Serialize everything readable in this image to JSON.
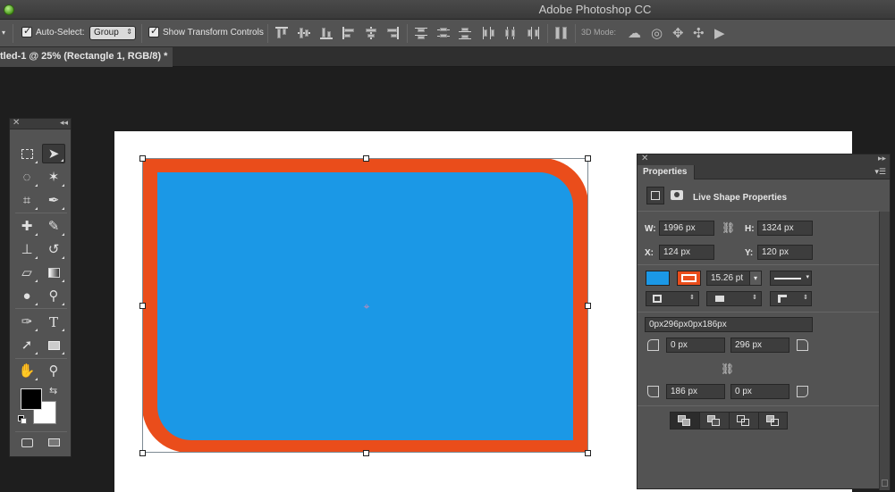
{
  "app": {
    "title": "Adobe Photoshop CC"
  },
  "options_bar": {
    "auto_select_label": "Auto-Select:",
    "auto_select_value": "Group",
    "show_transform_label": "Show Transform Controls",
    "mode_3d_label": "3D Mode:"
  },
  "document": {
    "tab_label": "tled-1 @ 25% (Rectangle 1, RGB/8) *"
  },
  "canvas": {
    "fill_color": "#1b98e6",
    "stroke_color": "#ea4d1b",
    "background_color": "#ffffff"
  },
  "tools": {
    "foreground_color": "#000000",
    "background_color": "#ffffff",
    "items": [
      "marquee-tool",
      "move-tool",
      "lasso-tool",
      "magic-wand-tool",
      "crop-tool",
      "eyedropper-tool",
      "healing-brush-tool",
      "brush-tool",
      "clone-stamp-tool",
      "history-brush-tool",
      "eraser-tool",
      "gradient-tool",
      "blur-tool",
      "dodge-tool",
      "pen-tool",
      "type-tool",
      "path-selection-tool",
      "rectangle-tool",
      "hand-tool",
      "zoom-tool",
      "quick-mask",
      "screen-mode"
    ]
  },
  "properties": {
    "tab_label": "Properties",
    "section_title": "Live Shape Properties",
    "w_label": "W:",
    "w_value": "1996 px",
    "h_label": "H:",
    "h_value": "1324 px",
    "x_label": "X:",
    "x_value": "124 px",
    "y_label": "Y:",
    "y_value": "120 px",
    "stroke_width": "15.26 pt",
    "radius_summary": "0px296px0px186px",
    "radius_tl": "0 px",
    "radius_tr": "296 px",
    "radius_bl": "186 px",
    "radius_br": "0 px",
    "fill_swatch_color": "#1b98e6",
    "stroke_swatch_color": "#ea4d1b"
  }
}
